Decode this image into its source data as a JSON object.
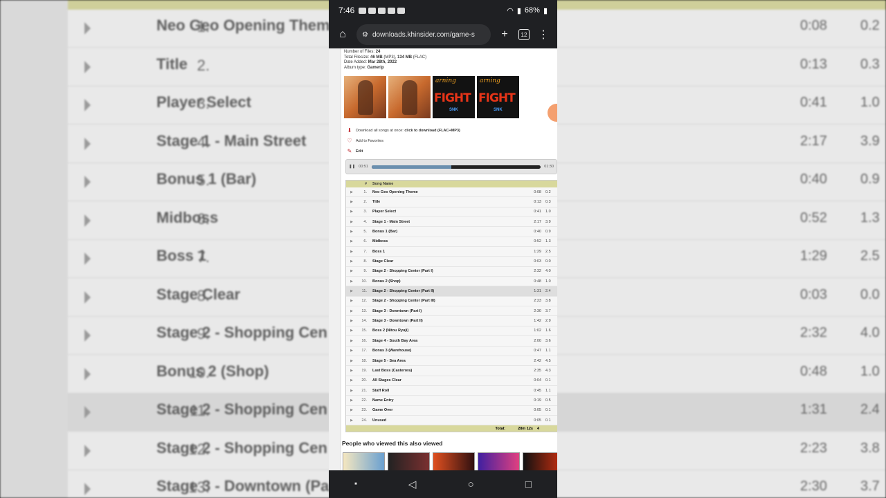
{
  "status_bar": {
    "time": "7:46",
    "battery": "68%"
  },
  "browser": {
    "url": "downloads.khinsider.com/game-s",
    "tab_count": "12"
  },
  "album_meta": [
    {
      "label": "Number of Files:",
      "value": "24"
    },
    {
      "label": "Total Filesize:",
      "value": "46 MB",
      "value2": "(MP3),",
      "value3": "134 MB",
      "value4": "(FLAC)"
    },
    {
      "label": "Date Added:",
      "value": "Mar 28th, 2022"
    },
    {
      "label": "Album type:",
      "value": "Gamerip"
    }
  ],
  "cover_art": {
    "logo_text": "FIGHT",
    "script_text": "arning",
    "badge": "SNK"
  },
  "actions": {
    "download_prefix": "Download all songs at once:",
    "download_link": "click to download (FLAC+MP3)",
    "favorites": "Add to Favorites",
    "edit": "Edit"
  },
  "player": {
    "elapsed": "00:51",
    "total": "01:30",
    "progress": 0.47
  },
  "table": {
    "headers": {
      "num": "#",
      "name": "Song Name"
    },
    "rows": [
      {
        "num": "1.",
        "name": "Neo Geo Opening Theme",
        "dur": "0:08",
        "size": "0.2"
      },
      {
        "num": "2.",
        "name": "Title",
        "dur": "0:13",
        "size": "0.3"
      },
      {
        "num": "3.",
        "name": "Player Select",
        "dur": "0:41",
        "size": "1.0"
      },
      {
        "num": "4.",
        "name": "Stage 1 - Main Street",
        "dur": "2:17",
        "size": "3.9"
      },
      {
        "num": "5.",
        "name": "Bonus 1 (Bar)",
        "dur": "0:40",
        "size": "0.9"
      },
      {
        "num": "6.",
        "name": "Midboss",
        "dur": "0:52",
        "size": "1.3"
      },
      {
        "num": "7.",
        "name": "Boss 1",
        "dur": "1:29",
        "size": "2.5"
      },
      {
        "num": "8.",
        "name": "Stage Clear",
        "dur": "0:03",
        "size": "0.0"
      },
      {
        "num": "9.",
        "name": "Stage 2 - Shopping Center (Part I)",
        "dur": "2:32",
        "size": "4.0"
      },
      {
        "num": "10.",
        "name": "Bonus 2 (Shop)",
        "dur": "0:48",
        "size": "1.0"
      },
      {
        "num": "11.",
        "name": "Stage 2 - Shopping Center (Part II)",
        "dur": "1:31",
        "size": "2.4"
      },
      {
        "num": "12.",
        "name": "Stage 2 - Shopping Center (Part III)",
        "dur": "2:23",
        "size": "3.8"
      },
      {
        "num": "13.",
        "name": "Stage 3 - Downtown (Part I)",
        "dur": "2:30",
        "size": "3.7"
      },
      {
        "num": "14.",
        "name": "Stage 3 - Downtown (Part II)",
        "dur": "1:42",
        "size": "2.9"
      },
      {
        "num": "15.",
        "name": "Boss 2 (Nitou Ryuji)",
        "dur": "1:02",
        "size": "1.6"
      },
      {
        "num": "16.",
        "name": "Stage 4 - South Bay Area",
        "dur": "2:00",
        "size": "3.6"
      },
      {
        "num": "17.",
        "name": "Bonus 3 (Warehouse)",
        "dur": "0:47",
        "size": "1.1"
      },
      {
        "num": "18.",
        "name": "Stage 5 - Sea Area",
        "dur": "2:42",
        "size": "4.5"
      },
      {
        "num": "19.",
        "name": "Last Boss (Casterora)",
        "dur": "2:35",
        "size": "4.3"
      },
      {
        "num": "20.",
        "name": "All Stages Clear",
        "dur": "0:04",
        "size": "0.1"
      },
      {
        "num": "21.",
        "name": "Staff Roll",
        "dur": "0:45",
        "size": "1.1"
      },
      {
        "num": "22.",
        "name": "Name Entry",
        "dur": "0:19",
        "size": "0.5"
      },
      {
        "num": "23.",
        "name": "Game Over",
        "dur": "0:05",
        "size": "0.1"
      },
      {
        "num": "24.",
        "name": "Unused",
        "dur": "0:05",
        "size": "0.1"
      }
    ],
    "highlighted_index": 10,
    "footer": {
      "label": "Total:",
      "dur": "28m 12s",
      "size": "4"
    }
  },
  "also_viewed": {
    "title": "People who viewed this also viewed"
  },
  "background_rows": [
    {
      "num": "1.",
      "name": "Neo Geo Opening Theme",
      "dur": "0:08",
      "size": "0.2"
    },
    {
      "num": "2.",
      "name": "Title",
      "dur": "0:13",
      "size": "0.3"
    },
    {
      "num": "3.",
      "name": "Player Select",
      "dur": "0:41",
      "size": "1.0"
    },
    {
      "num": "4.",
      "name": "Stage 1 - Main Street",
      "dur": "2:17",
      "size": "3.9"
    },
    {
      "num": "5.",
      "name": "Bonus 1 (Bar)",
      "dur": "0:40",
      "size": "0.9"
    },
    {
      "num": "6.",
      "name": "Midboss",
      "dur": "0:52",
      "size": "1.3"
    },
    {
      "num": "7.",
      "name": "Boss 1",
      "dur": "1:29",
      "size": "2.5"
    },
    {
      "num": "8.",
      "name": "Stage Clear",
      "dur": "0:03",
      "size": "0.0"
    },
    {
      "num": "9.",
      "name": "Stage 2 - Shopping Cen",
      "dur": "2:32",
      "size": "4.0"
    },
    {
      "num": "10.",
      "name": "Bonus 2 (Shop)",
      "dur": "0:48",
      "size": "1.0"
    },
    {
      "num": "11.",
      "name": "Stage 2 - Shopping Cen",
      "dur": "1:31",
      "size": "2.4"
    },
    {
      "num": "12.",
      "name": "Stage 2 - Shopping Cen",
      "dur": "2:23",
      "size": "3.8"
    },
    {
      "num": "13.",
      "name": "Stage 3 - Downtown (Pa",
      "dur": "2:30",
      "size": "3.7"
    }
  ],
  "colors": {
    "table_header": "#d8d89c",
    "highlight_row": "#dedede",
    "progress_fill": "#6a8fae",
    "chrome_dark": "#1f2023"
  }
}
